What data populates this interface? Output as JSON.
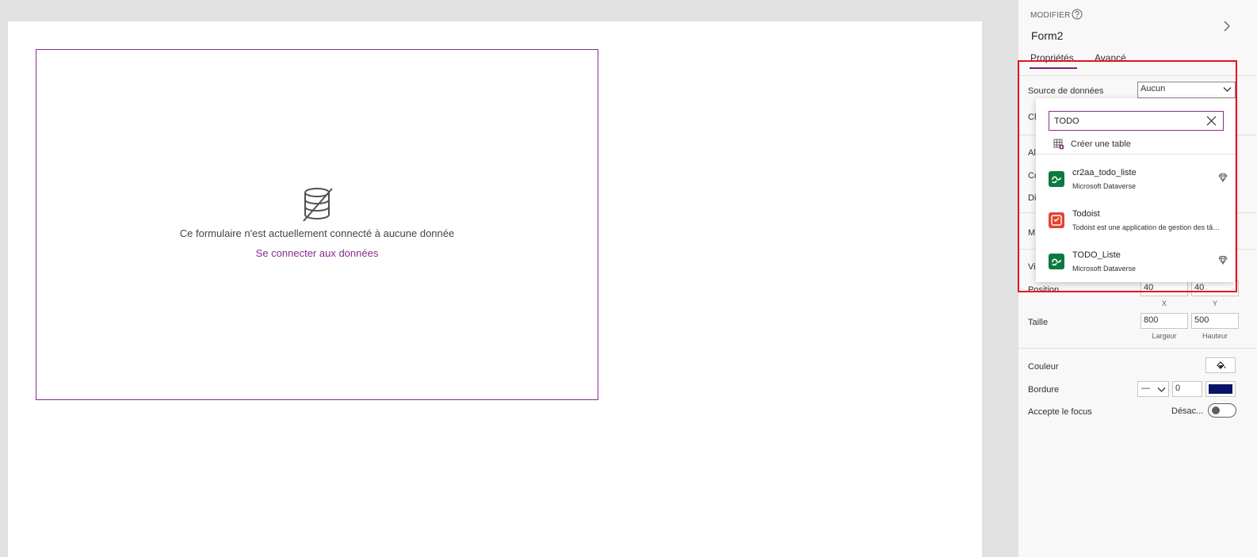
{
  "canvas": {
    "empty_message": "Ce formulaire n'est actuellement connecté à aucune donnée",
    "connect_link": "Se connecter aux données"
  },
  "panel": {
    "modifier_label": "MODIFIER",
    "control_name": "Form2",
    "tabs": [
      {
        "label": "Propriétés",
        "active": true
      },
      {
        "label": "Avancé",
        "active": false
      }
    ],
    "datasource": {
      "label": "Source de données",
      "value": "Aucun"
    },
    "clipped_labels": [
      "Ch",
      "Al",
      "Co",
      "Di",
      "M",
      "Vi"
    ],
    "position": {
      "label": "Position",
      "x": "40",
      "y": "40",
      "x_label": "X",
      "y_label": "Y"
    },
    "size": {
      "label": "Taille",
      "width": "800",
      "height": "500",
      "width_label": "Largeur",
      "height_label": "Hauteur"
    },
    "color": {
      "label": "Couleur"
    },
    "border": {
      "label": "Bordure",
      "style": "—",
      "width": "0",
      "color": "#0a1466"
    },
    "focus": {
      "label": "Accepte le focus",
      "status": "Désac..."
    }
  },
  "dropdown": {
    "search_value": "TODO",
    "create_label": "Créer une table",
    "items": [
      {
        "name": "cr2aa_todo_liste",
        "description": "Microsoft Dataverse",
        "icon": "dataverse-icon",
        "premium": true
      },
      {
        "name": "Todoist",
        "description": "Todoist est une application de gestion des tâches",
        "icon": "todoist-icon",
        "premium": false
      },
      {
        "name": "TODO_Liste",
        "description": "Microsoft Dataverse",
        "icon": "dataverse-icon",
        "premium": true
      }
    ]
  },
  "colors": {
    "accent": "#742774",
    "link": "#8a2b8f",
    "highlight": "#e81123",
    "dataverse": "#0b7a3e",
    "todoist": "#e44332"
  }
}
